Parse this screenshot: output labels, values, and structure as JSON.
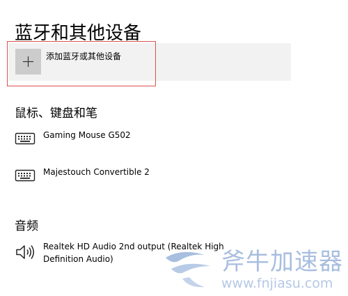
{
  "header": {
    "title": "蓝牙和其他设备"
  },
  "add_device": {
    "label": "添加蓝牙或其他设备",
    "icon": "plus-icon"
  },
  "sections": {
    "input_devices": {
      "heading": "鼠标、键盘和笔",
      "devices": [
        {
          "name": "Gaming Mouse G502",
          "icon": "keyboard-icon"
        },
        {
          "name": "Majestouch Convertible 2",
          "icon": "keyboard-icon"
        }
      ]
    },
    "audio": {
      "heading": "音频",
      "devices": [
        {
          "name": "Realtek HD Audio 2nd output (Realtek High Definition Audio)",
          "icon": "speaker-icon"
        }
      ]
    }
  },
  "watermark": {
    "brand": "斧牛加速器",
    "url": "www.fnjiasu.com"
  },
  "colors": {
    "add_row_bg": "#f2f2f2",
    "plus_box_bg": "#cccccc",
    "highlight_border": "#d9534f",
    "watermark": "#a8bedf"
  }
}
